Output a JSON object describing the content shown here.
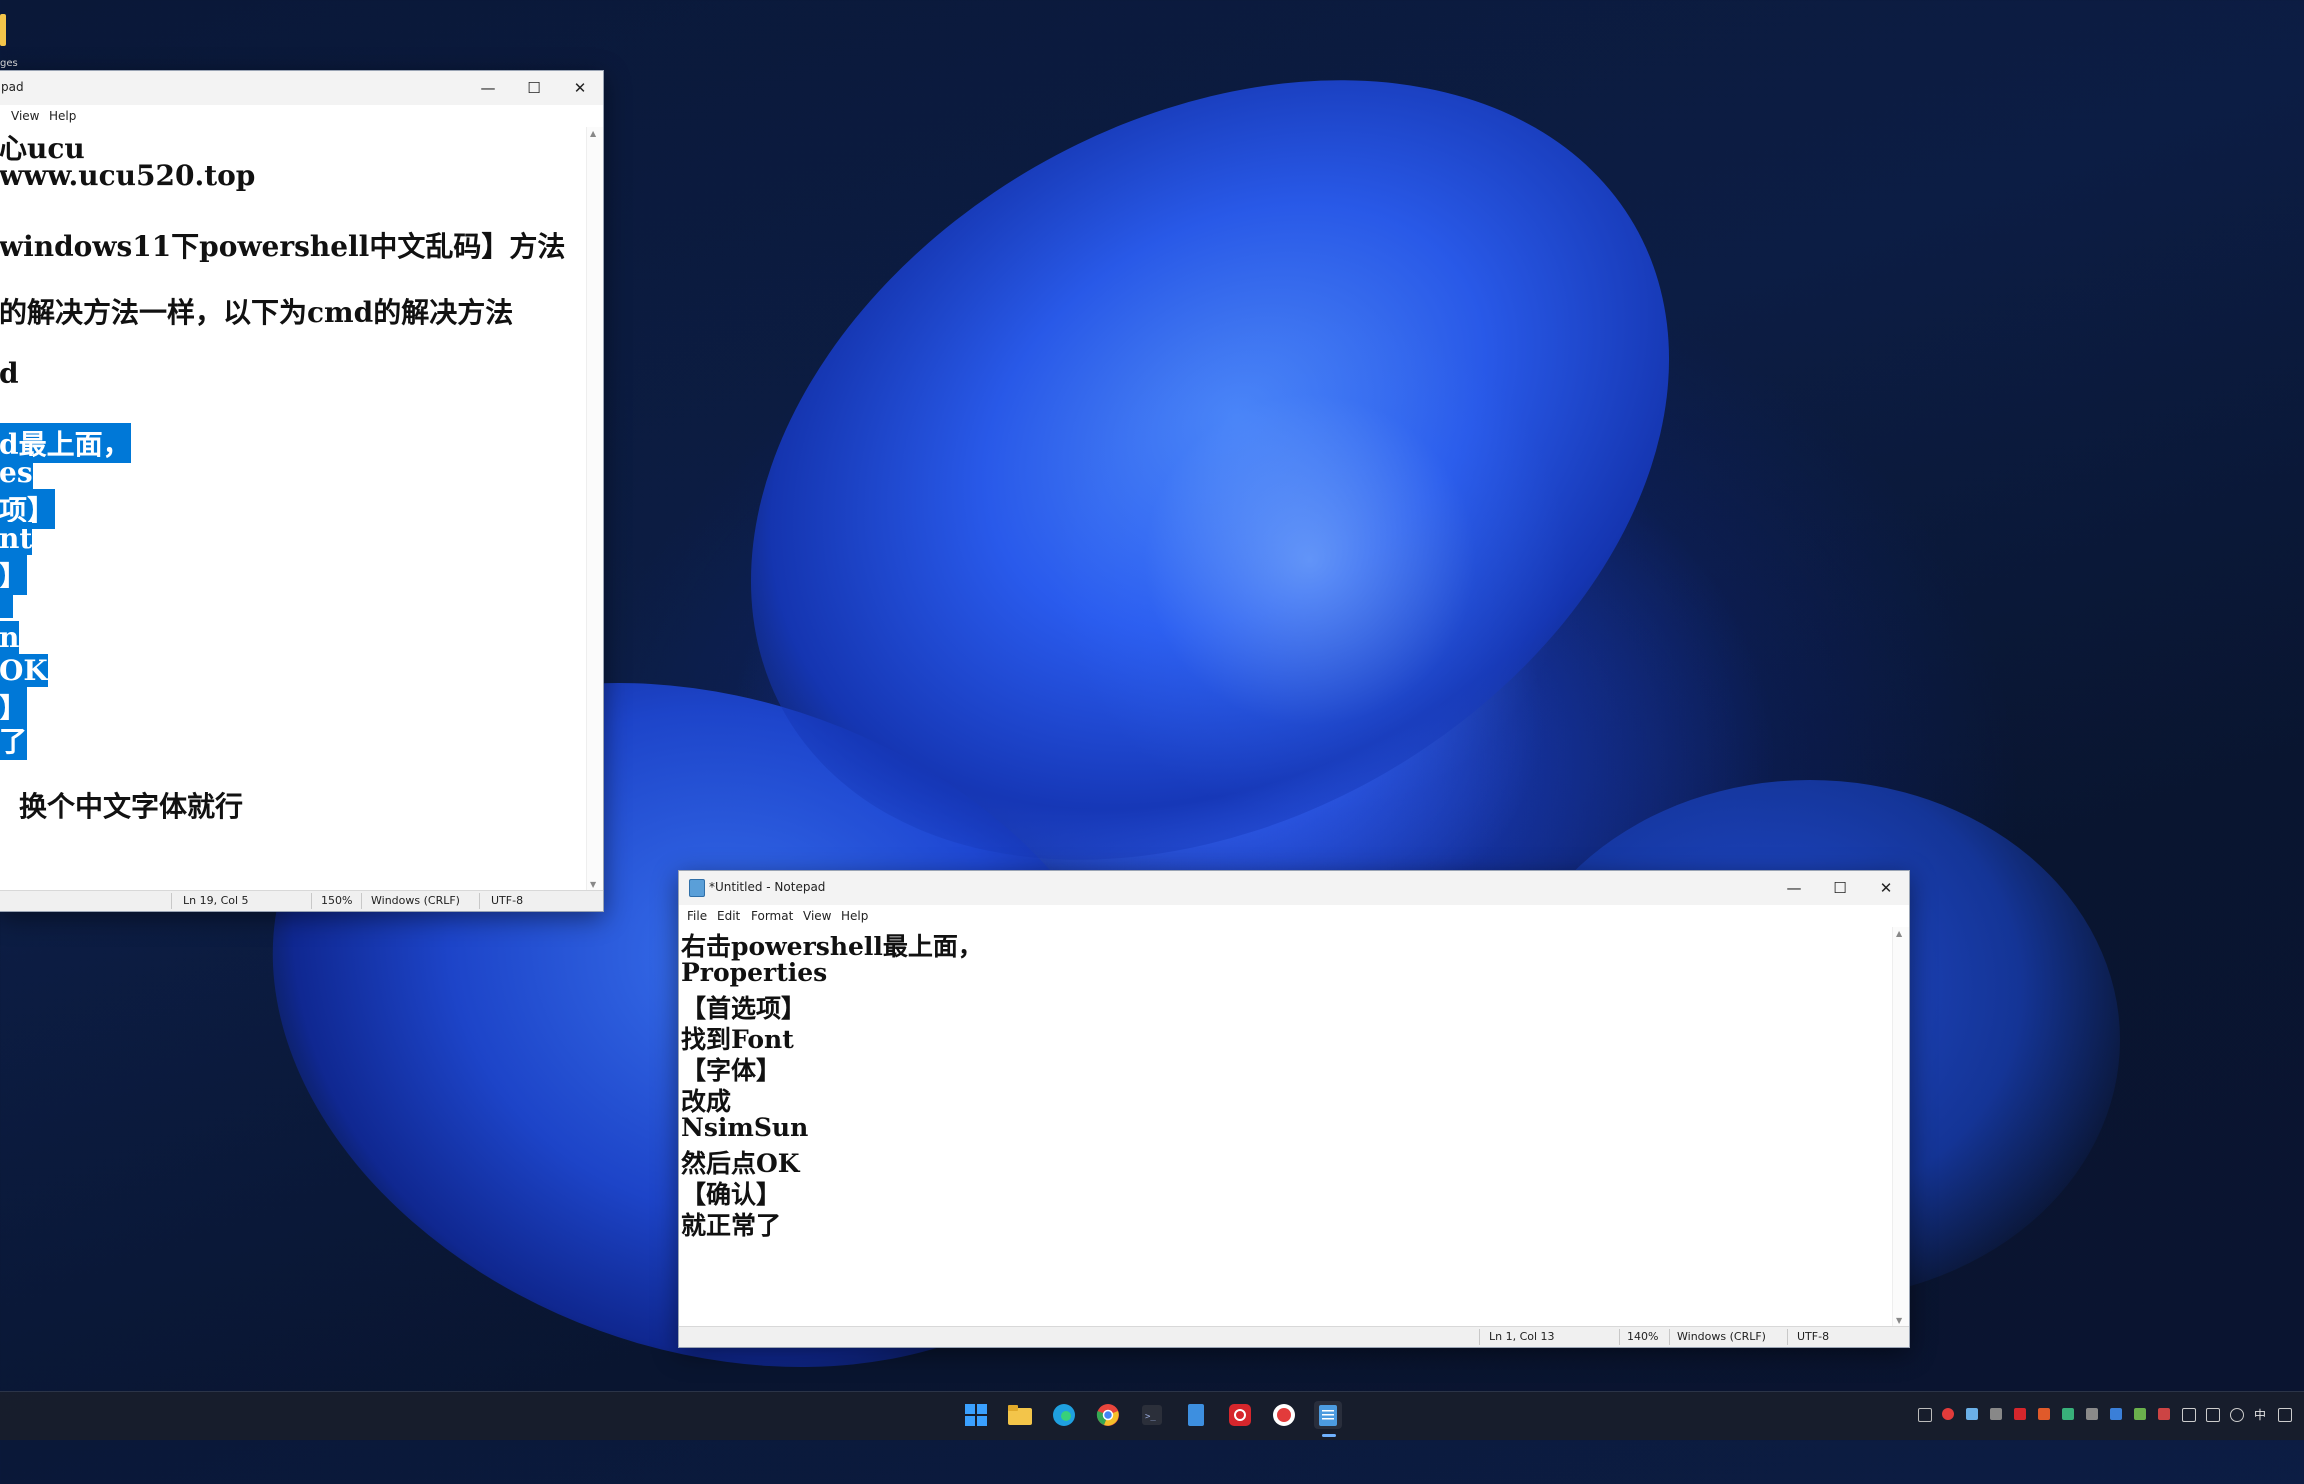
{
  "desktop": {
    "icon_label": "ges"
  },
  "back_window": {
    "title": "pad",
    "controls": {
      "minimize": "—",
      "maximize": "☐",
      "close": "✕"
    },
    "menu": [
      "View",
      "Help"
    ],
    "lines": [
      {
        "text": "心ucu",
        "selected": false
      },
      {
        "text": "www.ucu520.top",
        "selected": false
      },
      {
        "text": "windows11下powershell中文乱码】方法",
        "selected": false
      },
      {
        "text": "的解决方法一样，以下为cmd的解决方法",
        "selected": false
      },
      {
        "text": "d",
        "selected": false
      },
      {
        "text": "d最上面，",
        "selected": true
      },
      {
        "text": "es",
        "selected": true
      },
      {
        "text": "项】",
        "selected": true
      },
      {
        "text": "nt",
        "selected": true
      },
      {
        "text": "】",
        "selected": true
      },
      {
        "text": "",
        "selected": true
      },
      {
        "text": "n",
        "selected": true
      },
      {
        "text": "OK",
        "selected": true
      },
      {
        "text": "】",
        "selected": true
      },
      {
        "text": "了",
        "selected": true
      },
      {
        "text": "换个中文字体就行",
        "selected": false
      }
    ],
    "status": {
      "position": "Ln 19, Col 5",
      "zoom": "150%",
      "line_ending": "Windows (CRLF)",
      "encoding": "UTF-8"
    }
  },
  "front_window": {
    "title": "*Untitled - Notepad",
    "controls": {
      "minimize": "—",
      "maximize": "☐",
      "close": "✕"
    },
    "menu": [
      "File",
      "Edit",
      "Format",
      "View",
      "Help"
    ],
    "lines": [
      "右击powershell最上面，",
      "Properties",
      "【首选项】",
      "找到Font",
      "【字体】",
      "改成",
      "NsimSun",
      "然后点OK",
      "【确认】",
      "就正常了"
    ],
    "status": {
      "position": "Ln 1, Col 13",
      "zoom": "140%",
      "line_ending": "Windows (CRLF)",
      "encoding": "UTF-8"
    }
  },
  "taskbar": {
    "apps": [
      {
        "name": "start-icon",
        "color": "#3aa0ff"
      },
      {
        "name": "file-explorer-icon",
        "color": "#f3c54a"
      },
      {
        "name": "edge-icon",
        "color": "#1fa0e0"
      },
      {
        "name": "chrome-icon",
        "color": "#e8453c"
      },
      {
        "name": "terminal-icon",
        "color": "#2b2f3a"
      },
      {
        "name": "document-icon",
        "color": "#3d8fe0"
      },
      {
        "name": "netease-music-icon",
        "color": "#d6262c"
      },
      {
        "name": "record-icon",
        "color": "#e23b3b"
      },
      {
        "name": "notepad-icon",
        "color": "#4c9be0"
      }
    ],
    "tray_lang": "中"
  }
}
